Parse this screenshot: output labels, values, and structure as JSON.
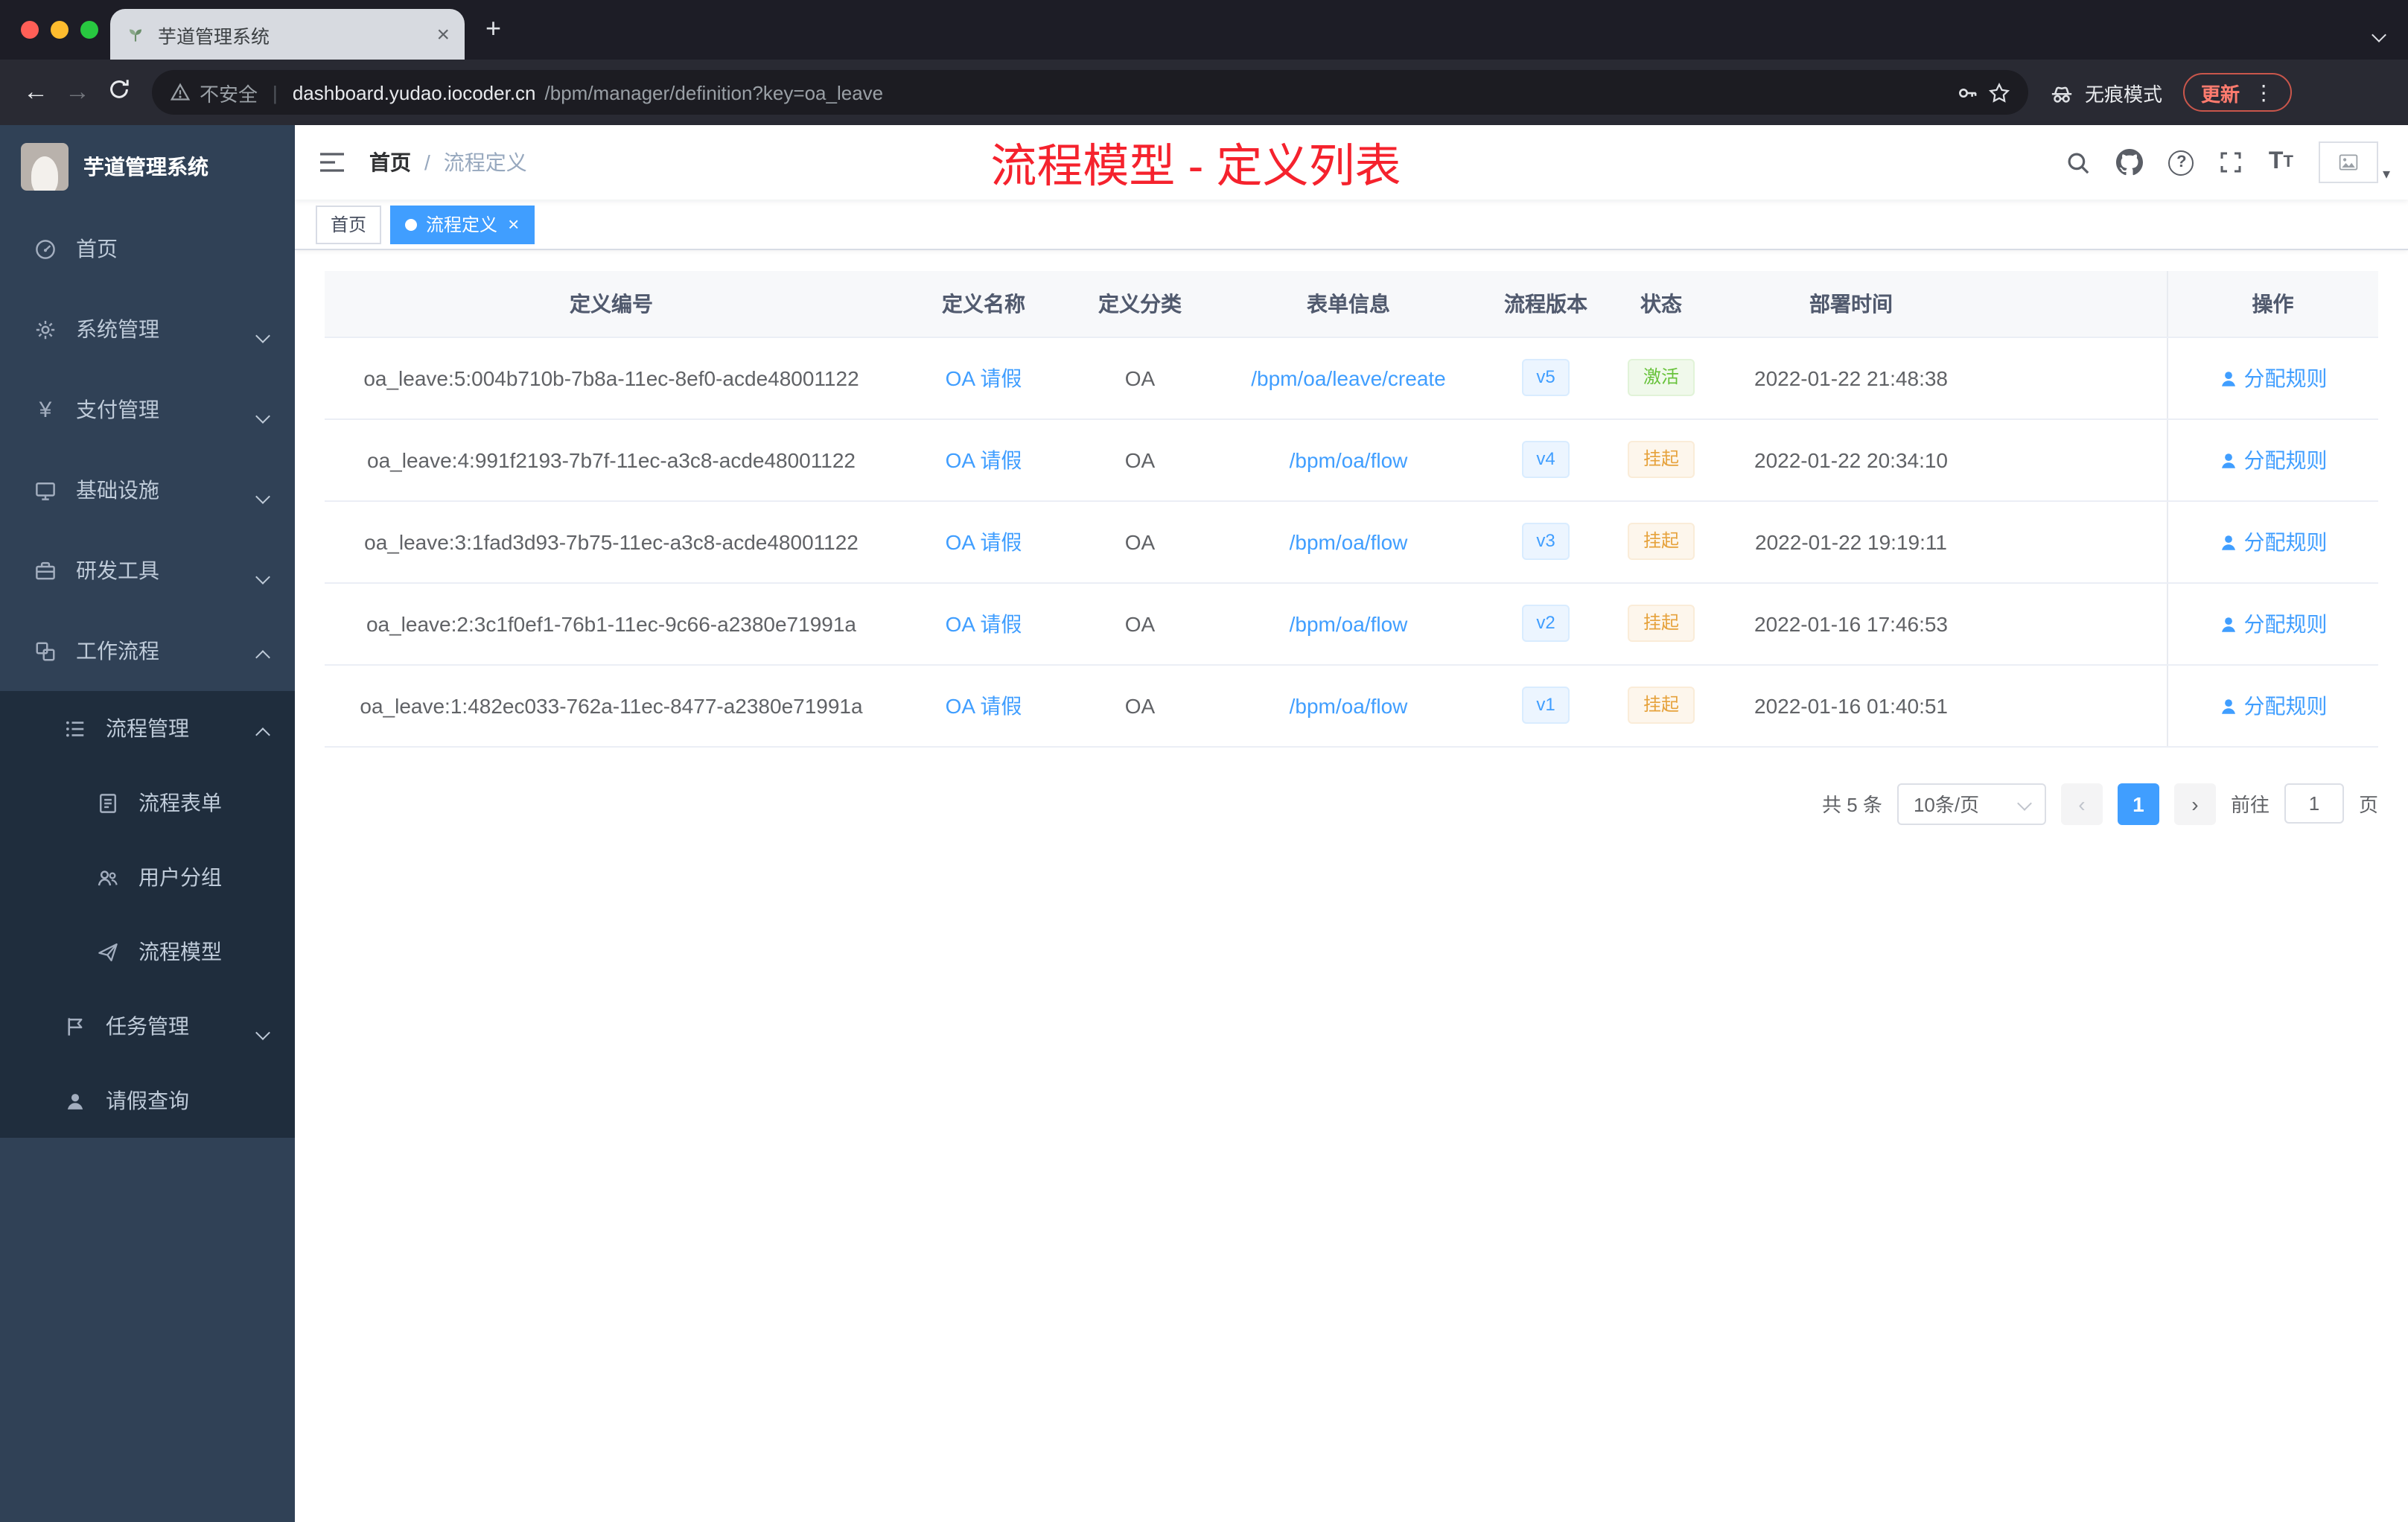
{
  "browser": {
    "tab_title": "芋道管理系统",
    "security_label": "不安全",
    "url_domain": "dashboard.yudao.iocoder.cn",
    "url_path": "/bpm/manager/definition?key=oa_leave",
    "incognito_label": "无痕模式",
    "update_label": "更新"
  },
  "sidebar": {
    "logo_title": "芋道管理系统",
    "items": [
      {
        "key": "home",
        "label": "首页",
        "icon": "dashboard-icon",
        "level": 0
      },
      {
        "key": "system",
        "label": "系统管理",
        "icon": "gear-icon",
        "level": 0,
        "chevron": "down"
      },
      {
        "key": "payment",
        "label": "支付管理",
        "icon": "yen-icon",
        "level": 0,
        "chevron": "down"
      },
      {
        "key": "infrastructure",
        "label": "基础设施",
        "icon": "monitor-icon",
        "level": 0,
        "chevron": "down"
      },
      {
        "key": "devtools",
        "label": "研发工具",
        "icon": "toolbox-icon",
        "level": 0,
        "chevron": "down"
      },
      {
        "key": "workflow",
        "label": "工作流程",
        "icon": "suitcase-icon",
        "level": 0,
        "chevron": "up"
      },
      {
        "key": "process-mgmt",
        "label": "流程管理",
        "icon": "tree-icon",
        "level": 1,
        "chevron": "up",
        "dark": true
      },
      {
        "key": "process-form",
        "label": "流程表单",
        "icon": "form-icon",
        "level": 2,
        "dark": true
      },
      {
        "key": "user-group",
        "label": "用户分组",
        "icon": "people-icon",
        "level": 2,
        "dark": true
      },
      {
        "key": "process-model",
        "label": "流程模型",
        "icon": "send-icon",
        "level": 2,
        "dark": true
      },
      {
        "key": "task-mgmt",
        "label": "任务管理",
        "icon": "task-icon",
        "level": 1,
        "chevron": "down",
        "dark": true
      },
      {
        "key": "leave-query",
        "label": "请假查询",
        "icon": "user-icon",
        "level": 1,
        "dark": true
      }
    ]
  },
  "header": {
    "breadcrumb_home": "首页",
    "breadcrumb_sep": "/",
    "breadcrumb_current": "流程定义",
    "annotation": "流程模型 - 定义列表"
  },
  "tags": {
    "home": "首页",
    "current": "流程定义"
  },
  "table": {
    "columns": [
      "定义编号",
      "定义名称",
      "定义分类",
      "表单信息",
      "流程版本",
      "状态",
      "部署时间",
      "操作"
    ],
    "rows": [
      {
        "id": "oa_leave:5:004b710b-7b8a-11ec-8ef0-acde48001122",
        "name": "OA 请假",
        "category": "OA",
        "form": "/bpm/oa/leave/create",
        "version": "v5",
        "status": "激活",
        "status_type": "success",
        "deploy_time": "2022-01-22 21:48:38",
        "action": "分配规则"
      },
      {
        "id": "oa_leave:4:991f2193-7b7f-11ec-a3c8-acde48001122",
        "name": "OA 请假",
        "category": "OA",
        "form": "/bpm/oa/flow",
        "version": "v4",
        "status": "挂起",
        "status_type": "warning",
        "deploy_time": "2022-01-22 20:34:10",
        "action": "分配规则"
      },
      {
        "id": "oa_leave:3:1fad3d93-7b75-11ec-a3c8-acde48001122",
        "name": "OA 请假",
        "category": "OA",
        "form": "/bpm/oa/flow",
        "version": "v3",
        "status": "挂起",
        "status_type": "warning",
        "deploy_time": "2022-01-22 19:19:11",
        "action": "分配规则"
      },
      {
        "id": "oa_leave:2:3c1f0ef1-76b1-11ec-9c66-a2380e71991a",
        "name": "OA 请假",
        "category": "OA",
        "form": "/bpm/oa/flow",
        "version": "v2",
        "status": "挂起",
        "status_type": "warning",
        "deploy_time": "2022-01-16 17:46:53",
        "action": "分配规则"
      },
      {
        "id": "oa_leave:1:482ec033-762a-11ec-8477-a2380e71991a",
        "name": "OA 请假",
        "category": "OA",
        "form": "/bpm/oa/flow",
        "version": "v1",
        "status": "挂起",
        "status_type": "warning",
        "deploy_time": "2022-01-16 01:40:51",
        "action": "分配规则"
      }
    ]
  },
  "pagination": {
    "total": "共 5 条",
    "page_size": "10条/页",
    "prev": "‹",
    "current_page": "1",
    "next": "›",
    "goto_label": "前往",
    "goto_value": "1",
    "goto_unit": "页"
  },
  "colors": {
    "accent": "#409eff",
    "success": "#67c23a",
    "warning": "#e6a23c",
    "annotation_red": "#f5222d",
    "sidebar_bg": "#304156",
    "sidebar_sub_bg": "#1f2d3d"
  }
}
